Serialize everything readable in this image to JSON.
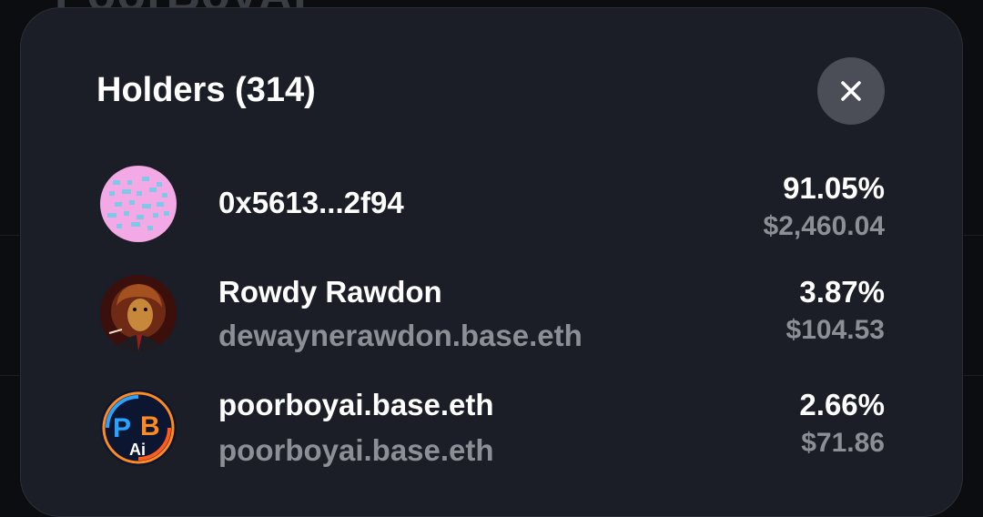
{
  "background": {
    "title": "PoorBoyAI"
  },
  "sheet": {
    "title": "Holders (314)"
  },
  "holders": [
    {
      "name": "0x5613...2f94",
      "subtitle": "",
      "percent": "91.05%",
      "value": "$2,460.04",
      "avatar": "pixel-pattern-avatar"
    },
    {
      "name": "Rowdy Rawdon",
      "subtitle": "dewaynerawdon.base.eth",
      "percent": "3.87%",
      "value": "$104.53",
      "avatar": "lion-avatar"
    },
    {
      "name": "poorboyai.base.eth",
      "subtitle": "poorboyai.base.eth",
      "percent": "2.66%",
      "value": "$71.86",
      "avatar": "pba-logo-avatar"
    }
  ],
  "colors": {
    "sheet": "#1b1e26",
    "muted_text": "#8c8f96",
    "close_button": "#4b4e56"
  }
}
